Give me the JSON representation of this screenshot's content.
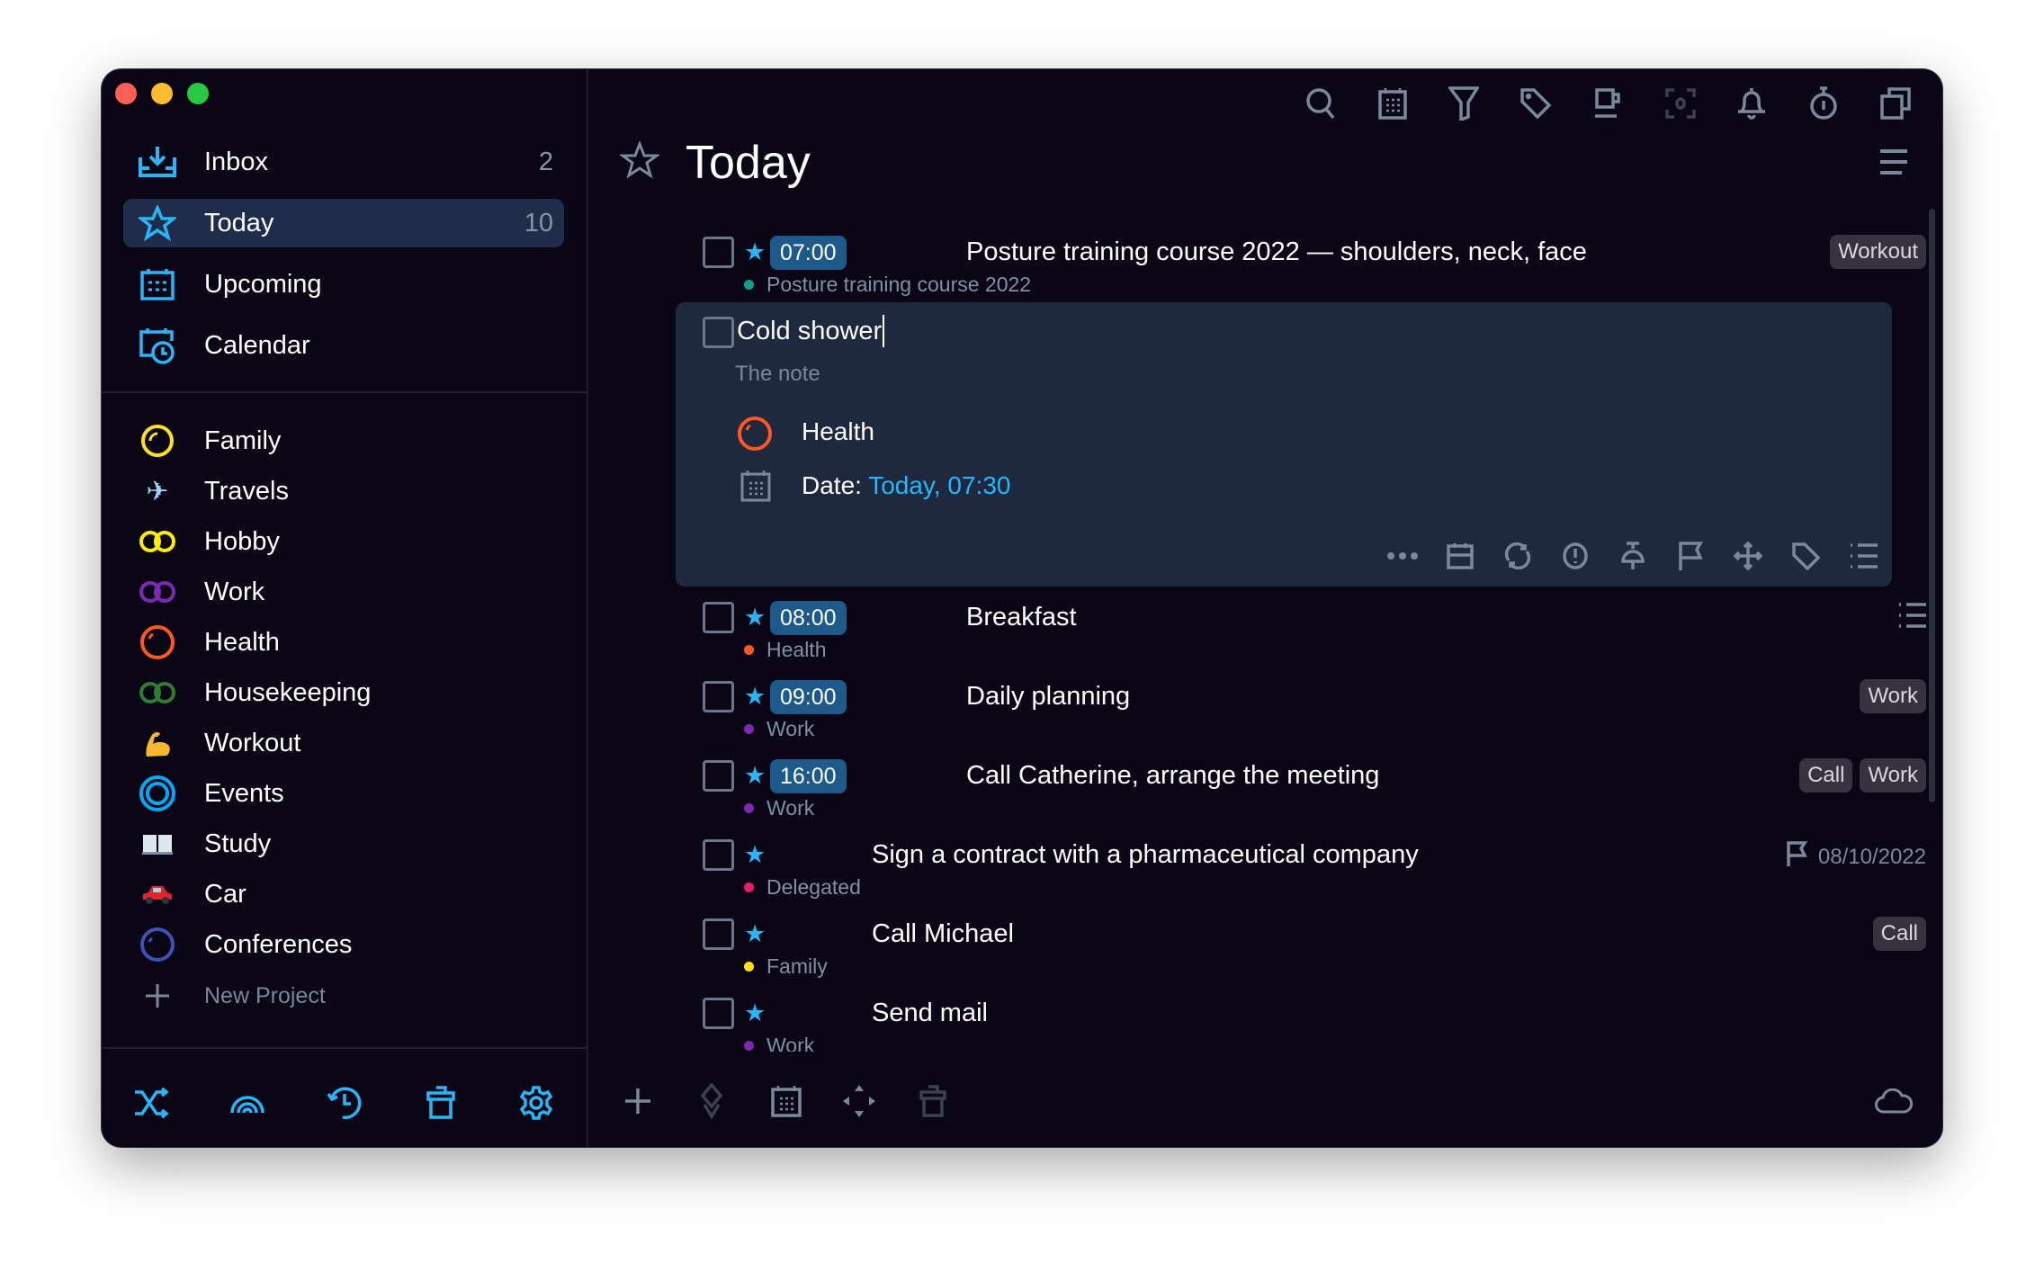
{
  "window": {
    "traffic_lights": [
      "#ff5f57",
      "#febc2e",
      "#28c840"
    ]
  },
  "sidebar": {
    "nav": [
      {
        "label": "Inbox",
        "count": "2",
        "icon": "inbox-icon"
      },
      {
        "label": "Today",
        "count": "10",
        "icon": "star-icon",
        "selected": true
      },
      {
        "label": "Upcoming",
        "count": "",
        "icon": "calendar-grid-icon"
      },
      {
        "label": "Calendar",
        "count": "",
        "icon": "calendar-clock-icon"
      }
    ],
    "projects": [
      {
        "label": "Family",
        "icon": "ring-icon",
        "color": "#ffe11a"
      },
      {
        "label": "Travels",
        "icon": "airplane-icon"
      },
      {
        "label": "Hobby",
        "icon": "double-ring-icon",
        "color": "#ffee00"
      },
      {
        "label": "Work",
        "icon": "double-ring-icon",
        "color": "#7b2ab3"
      },
      {
        "label": "Health",
        "icon": "ring-icon",
        "color": "#ff5722"
      },
      {
        "label": "Housekeeping",
        "icon": "double-ring-icon",
        "color": "#2e7d32"
      },
      {
        "label": "Workout",
        "icon": "flexed-biceps-icon"
      },
      {
        "label": "Events",
        "icon": "concentric-ring-icon",
        "color": "#03a9f4"
      },
      {
        "label": "Study",
        "icon": "open-book-icon"
      },
      {
        "label": "Car",
        "icon": "car-icon"
      },
      {
        "label": "Conferences",
        "icon": "ring-icon",
        "color": "#3f51b5"
      }
    ],
    "new_project": "New Project",
    "footer_icons": [
      "shuffle-icon",
      "rainbow-icon",
      "history-icon",
      "trash-icon",
      "gear-icon"
    ]
  },
  "main": {
    "title": "Today",
    "toolbar_icons": [
      "search-icon",
      "calendar-icon",
      "filter-icon",
      "tag-icon",
      "coffee-icon",
      "focus-icon",
      "bell-icon",
      "timer-icon",
      "copy-icon"
    ],
    "tasks": [
      {
        "time": "07:00",
        "title": "Posture training course 2022 — shoulders, neck, face",
        "project": "Posture training course 2022",
        "project_color": "#14a085",
        "tags": [
          "Workout"
        ],
        "starred": true
      },
      {
        "time": "08:00",
        "title": "Breakfast",
        "project": "Health",
        "project_color": "#ff5722",
        "tags": [],
        "starred": true,
        "has_checklist": true
      },
      {
        "time": "09:00",
        "title": "Daily planning",
        "project": "Work",
        "project_color": "#7b2ab3",
        "tags": [
          "Work"
        ],
        "starred": true
      },
      {
        "time": "16:00",
        "title": "Call Catherine, arrange the meeting",
        "project": "Work",
        "project_color": "#7b2ab3",
        "tags": [
          "Call",
          "Work"
        ],
        "starred": true
      },
      {
        "time": "",
        "title": "Sign a contract with a pharmaceutical company",
        "project": "Delegated",
        "project_color": "#e91e63",
        "tags": [],
        "deadline": "08/10/2022",
        "starred": true
      },
      {
        "time": "",
        "title": "Call Michael",
        "project": "Family",
        "project_color": "#ffe11a",
        "tags": [
          "Call"
        ],
        "starred": true
      },
      {
        "time": "",
        "title": "Send mail",
        "project": "Work",
        "project_color": "#7b2ab3",
        "tags": [],
        "starred": true
      }
    ],
    "editing": {
      "title": "Cold shower",
      "note": "The note",
      "project": "Health",
      "date_label": "Date:",
      "date_value": "Today, 07:30",
      "actions": [
        "more-icon",
        "calendar-icon",
        "repeat-icon",
        "priority-icon",
        "pin-icon",
        "flag-icon",
        "move-icon",
        "tag-icon",
        "checklist-icon"
      ]
    },
    "footer_icons": [
      "add-icon",
      "layers-icon",
      "calendar-icon",
      "move-icon",
      "trash-icon",
      "cloud-icon"
    ]
  },
  "colors": {
    "accent": "#29b6f6",
    "background": "#0a0616",
    "panel": "#1e2940",
    "selected": "#1f2d4a"
  }
}
